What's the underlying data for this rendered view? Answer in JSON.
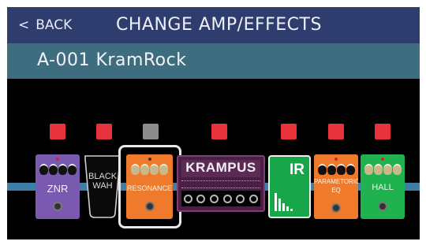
{
  "header": {
    "back_label": "BACK",
    "title": "CHANGE AMP/EFFECTS"
  },
  "patch": {
    "name": "A-001 KramRock"
  },
  "colors": {
    "header_bg": "#2e3d6e",
    "patch_bar_bg": "#3f6d80",
    "signal_line": "#3c7fa8",
    "led_on": "#e8323c",
    "led_off": "#8c8c8c",
    "selection": "#e8e8e8"
  },
  "chain": [
    {
      "label": "ZNR",
      "state": "on",
      "selected": false
    },
    {
      "label": "BLACK WAH",
      "state": "on",
      "selected": false
    },
    {
      "label": "RESONANCE",
      "state": "off",
      "selected": true
    },
    {
      "label": "KRAMPUS",
      "state": "on",
      "selected": false
    },
    {
      "label": "IR",
      "state": "on",
      "selected": false
    },
    {
      "label": "PARAMETORIC EQ",
      "state": "on",
      "selected": false
    },
    {
      "label": "HALL",
      "state": "on",
      "selected": false
    }
  ]
}
